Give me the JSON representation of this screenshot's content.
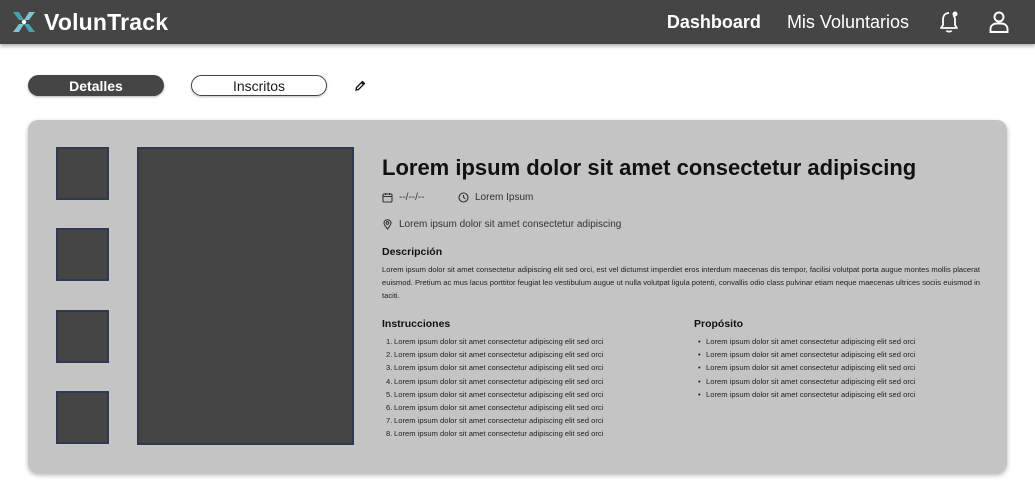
{
  "app": {
    "name": "VolunTrack"
  },
  "nav": {
    "items": [
      {
        "label": "Dashboard",
        "active": true
      },
      {
        "label": "Mis Voluntarios",
        "active": false
      }
    ],
    "icons": [
      "bell-icon",
      "user-icon"
    ]
  },
  "tabs": [
    {
      "label": "Detalles",
      "active": true
    },
    {
      "label": "Inscritos",
      "active": false
    }
  ],
  "event": {
    "title": "Lorem ipsum dolor sit amet consectetur adipiscing",
    "date": "--/--/--",
    "time": "Lorem Ipsum",
    "location": "Lorem ipsum dolor sit amet consectetur adipiscing",
    "description_label": "Descripción",
    "description": "Lorem ipsum dolor sit amet consectetur adipiscing elit sed orci, est vel dictumst imperdiet eros interdum maecenas dis tempor, facilisi volutpat porta augue montes mollis placerat euismod. Pretium ac mus lacus porttitor feugiat leo vestibulum augue ut nulla volutpat ligula potenti, convallis odio class pulvinar etiam neque maecenas ultrices sociis euismod in taciti.",
    "instructions_label": "Instrucciones",
    "instructions": [
      "Lorem ipsum dolor sit amet consectetur adipiscing elit sed orci",
      "Lorem ipsum dolor sit amet consectetur adipiscing elit sed orci",
      "Lorem ipsum dolor sit amet consectetur adipiscing elit sed orci",
      "Lorem ipsum dolor sit amet consectetur adipiscing elit sed orci",
      "Lorem ipsum dolor sit amet consectetur adipiscing elit sed orci",
      "Lorem ipsum dolor sit amet consectetur adipiscing elit sed orci",
      "Lorem ipsum dolor sit amet consectetur adipiscing elit sed orci",
      "Lorem ipsum dolor sit amet consectetur adipiscing elit sed orci"
    ],
    "purpose_label": "Propósito",
    "purpose": [
      "Lorem ipsum dolor sit amet consectetur adipiscing elit sed orci",
      "Lorem ipsum dolor sit amet consectetur adipiscing elit sed orci",
      "Lorem ipsum dolor sit amet consectetur adipiscing elit sed orci",
      "Lorem ipsum dolor sit amet consectetur adipiscing elit sed orci",
      "Lorem ipsum dolor sit amet consectetur adipiscing elit sed orci"
    ]
  },
  "colors": {
    "navbar": "#454545",
    "card": "#c4c4c4",
    "image_placeholder": "#454545",
    "logo_accent": "#4a9fb0"
  }
}
